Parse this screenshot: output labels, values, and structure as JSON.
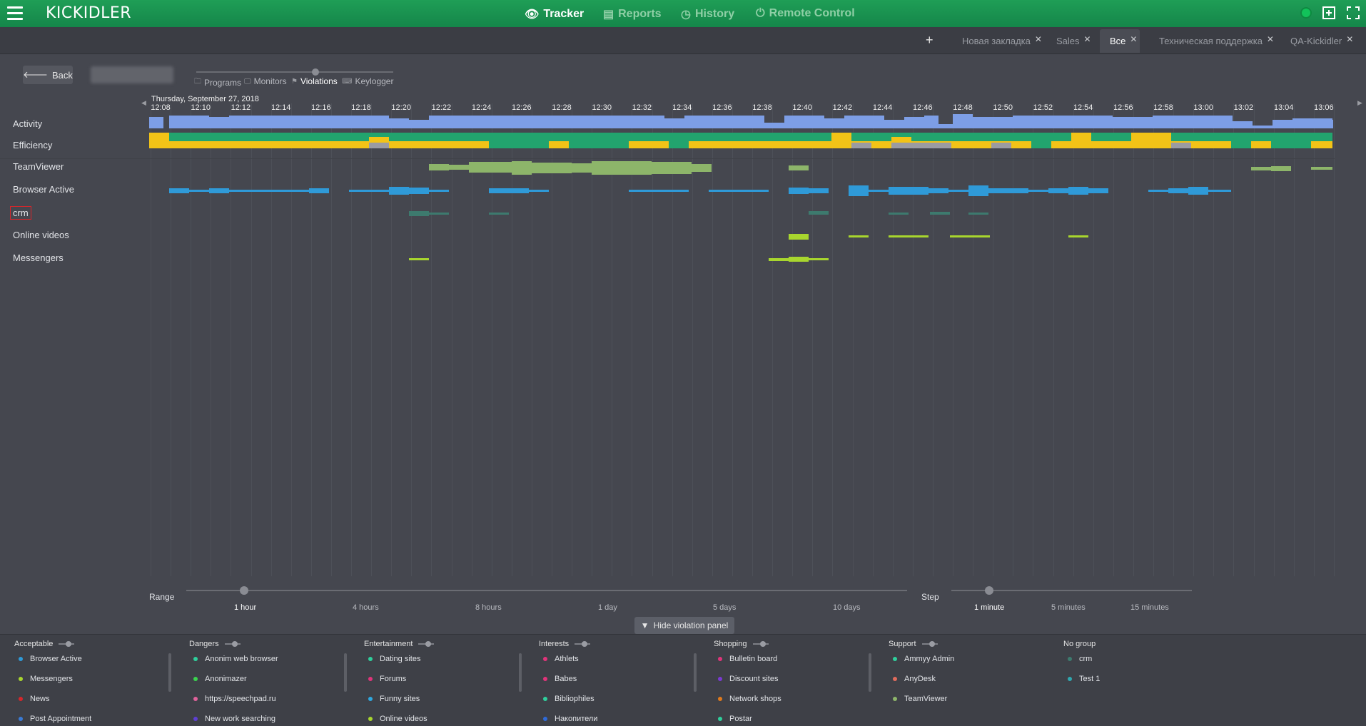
{
  "app": {
    "logo": "KICKIDLER"
  },
  "nav": [
    {
      "label": "Tracker",
      "active": true,
      "icon": "eye-icon"
    },
    {
      "label": "Reports",
      "active": false,
      "icon": "document-icon"
    },
    {
      "label": "History",
      "active": false,
      "icon": "history-icon"
    },
    {
      "label": "Remote Control",
      "active": false,
      "icon": "power-icon"
    }
  ],
  "tabs": [
    {
      "label": "Новая закладка",
      "active": false
    },
    {
      "label": "Sales",
      "active": false
    },
    {
      "label": "Все",
      "active": true
    },
    {
      "label": "Техническая поддержка",
      "active": false
    },
    {
      "label": "QA-Kickidler",
      "active": false
    }
  ],
  "back_label": "Back",
  "modes": [
    {
      "label": "Programs",
      "active": false
    },
    {
      "label": "Monitors",
      "active": false
    },
    {
      "label": "Violations",
      "active": true
    },
    {
      "label": "Keylogger",
      "active": false
    }
  ],
  "timeline": {
    "date": "Thursday, September 27, 2018",
    "ticks": [
      "12:08",
      "12:10",
      "12:12",
      "12:14",
      "12:16",
      "12:18",
      "12:20",
      "12:22",
      "12:24",
      "12:26",
      "12:28",
      "12:30",
      "12:32",
      "12:34",
      "12:36",
      "12:38",
      "12:40",
      "12:42",
      "12:44",
      "12:46",
      "12:48",
      "12:50",
      "12:52",
      "12:54",
      "12:56",
      "12:58",
      "13:00",
      "13:02",
      "13:04",
      "13:06"
    ],
    "rows": [
      "Activity",
      "Efficiency",
      "TeamViewer",
      "Browser Active",
      "crm",
      "Online videos",
      "Messengers"
    ],
    "colors": {
      "activity": "#7d9ee6",
      "efficiency_green": "#22a46e",
      "efficiency_yellow": "#f2c317",
      "efficiency_gray": "#9a9ba2",
      "teamviewer": "#8db56a",
      "browser": "#2f9ad8",
      "crm": "#3d7a6e",
      "videos": "#a8d62e",
      "messengers": "#a8d62e"
    }
  },
  "range": {
    "label": "Range",
    "options": [
      "1 hour",
      "4 hours",
      "8 hours",
      "1 day",
      "5 days",
      "10 days"
    ],
    "selected": "1 hour"
  },
  "step": {
    "label": "Step",
    "options": [
      "1 minute",
      "5 minutes",
      "15 minutes"
    ],
    "selected": "1 minute"
  },
  "hide_panel_label": "Hide violation panel",
  "groups": [
    {
      "name": "Acceptable",
      "items": [
        {
          "label": "Browser Active",
          "color": "#2f9ad8"
        },
        {
          "label": "Messengers",
          "color": "#a8d62e"
        },
        {
          "label": "News",
          "color": "#d6262b"
        },
        {
          "label": "Post Appointment",
          "color": "#3a7bd5"
        }
      ]
    },
    {
      "name": "Dangers",
      "items": [
        {
          "label": "Anonim web browser",
          "color": "#2fcf9c"
        },
        {
          "label": "Anonimazer",
          "color": "#3ad34f"
        },
        {
          "label": "https://speechpad.ru",
          "color": "#e0629b"
        },
        {
          "label": "New work searching",
          "color": "#5d3fd3"
        }
      ]
    },
    {
      "name": "Entertainment",
      "items": [
        {
          "label": "Dating sites",
          "color": "#2fcf9c"
        },
        {
          "label": "Forums",
          "color": "#e0347a"
        },
        {
          "label": "Funny sites",
          "color": "#2fa8e0"
        },
        {
          "label": "Online videos",
          "color": "#a8d62e"
        }
      ]
    },
    {
      "name": "Interests",
      "items": [
        {
          "label": "Athlets",
          "color": "#e0347a"
        },
        {
          "label": "Babes",
          "color": "#e0347a"
        },
        {
          "label": "Bibliophiles",
          "color": "#2fcf9c"
        },
        {
          "label": "Накопители",
          "color": "#2f6ad8"
        }
      ]
    },
    {
      "name": "Shopping",
      "items": [
        {
          "label": "Bulletin board",
          "color": "#e0347a"
        },
        {
          "label": "Discount sites",
          "color": "#7a3ad3"
        },
        {
          "label": "Network shops",
          "color": "#e07a1c"
        },
        {
          "label": "Postar",
          "color": "#2fcf9c"
        }
      ]
    },
    {
      "name": "Support",
      "items": [
        {
          "label": "Ammyy Admin",
          "color": "#2fcf9c"
        },
        {
          "label": "AnyDesk",
          "color": "#e06b5c"
        },
        {
          "label": "TeamViewer",
          "color": "#8db56a"
        }
      ]
    },
    {
      "name": "No group",
      "items": [
        {
          "label": "crm",
          "color": "#3d7a6e"
        },
        {
          "label": "Test 1",
          "color": "#2fa8b0"
        }
      ]
    }
  ]
}
